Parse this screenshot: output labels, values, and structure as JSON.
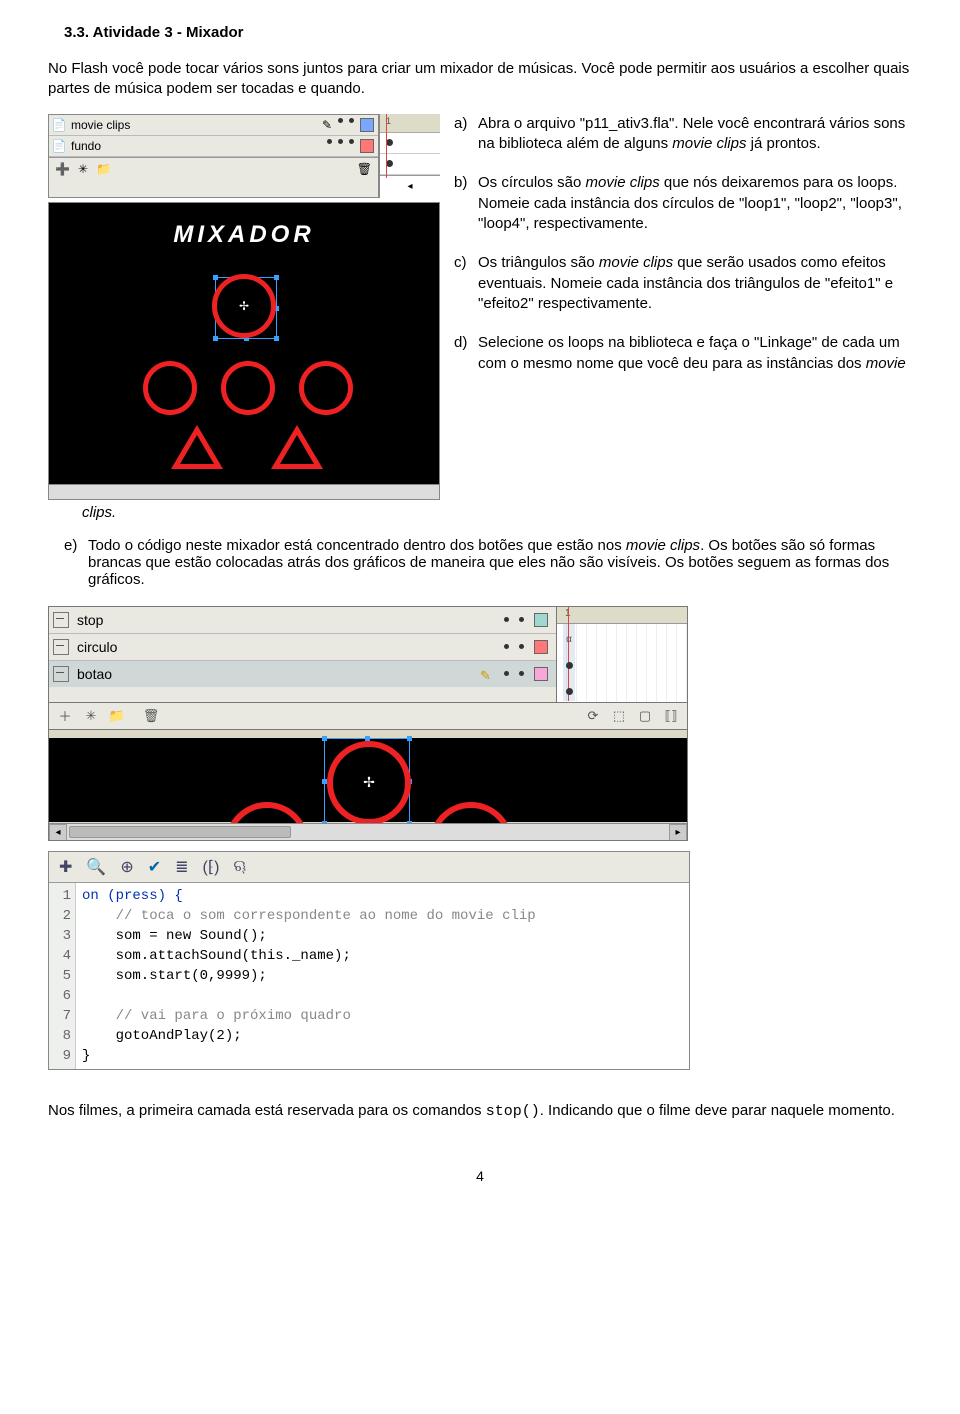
{
  "heading": "3.3. Atividade 3 - Mixador",
  "intro": "No Flash você pode tocar vários sons juntos para criar um mixador de músicas. Você pode permitir aos usuários a escolher quais partes de música podem ser tocadas e quando.",
  "timeline1": {
    "layer1": "movie clips",
    "layer2": "fundo",
    "stage_title": "MIXADOR"
  },
  "list": {
    "a_lab": "a)",
    "a_pre": "Abra o arquivo \"p11_ativ3.fla\". Nele você encontrará vários sons na biblioteca além de alguns ",
    "a_it": "movie clips",
    "a_post": " já prontos.",
    "b_lab": "b)",
    "b_pre": "Os círculos são ",
    "b_it": "movie clips",
    "b_post": " que nós deixaremos para os loops. Nomeie cada instância dos círculos de \"loop1\", \"loop2\", \"loop3\", \"loop4\", respectivamente.",
    "c_lab": "c)",
    "c_pre": "Os triângulos são ",
    "c_it": "movie clips",
    "c_post": " que serão usados como efeitos eventuais. Nomeie cada instância dos triângulos de \"efeito1\" e \"efeito2\" respectivamente.",
    "d_lab": "d)",
    "d_pre": "Selecione os loops na biblioteca e faça o \"Linkage\" de cada um com o mesmo nome que você deu para as instâncias dos ",
    "d_it": "movie"
  },
  "clips_word": "clips.",
  "item_e": {
    "lab": "e)",
    "pre": "Todo o código neste mixador está concentrado dentro dos botões que estão nos ",
    "it": "movie clips",
    "post": ". Os botões são só formas brancas que estão colocadas atrás dos gráficos de maneira que eles não são visíveis. Os botões seguem as formas dos gráficos."
  },
  "timeline2": {
    "layer1": "stop",
    "layer2": "circulo",
    "layer3": "botao",
    "tick": "1"
  },
  "code": {
    "l1": "on (press) {",
    "l2": "    // toca o som correspondente ao nome do movie clip",
    "l3": "    som = new Sound();",
    "l4": "    som.attachSound(this._name);",
    "l5": "    som.start(0,9999);",
    "l6": "",
    "l7": "    // vai para o próximo quadro",
    "l8": "    gotoAndPlay(2);",
    "l9": "}",
    "lines": [
      "1",
      "2",
      "3",
      "4",
      "5",
      "6",
      "7",
      "8",
      "9"
    ]
  },
  "final": {
    "pre": "Nos filmes, a primeira camada está reservada para os comandos ",
    "code": "stop()",
    "post": ". Indicando que o filme deve parar naquele momento."
  },
  "pagenum": "4"
}
